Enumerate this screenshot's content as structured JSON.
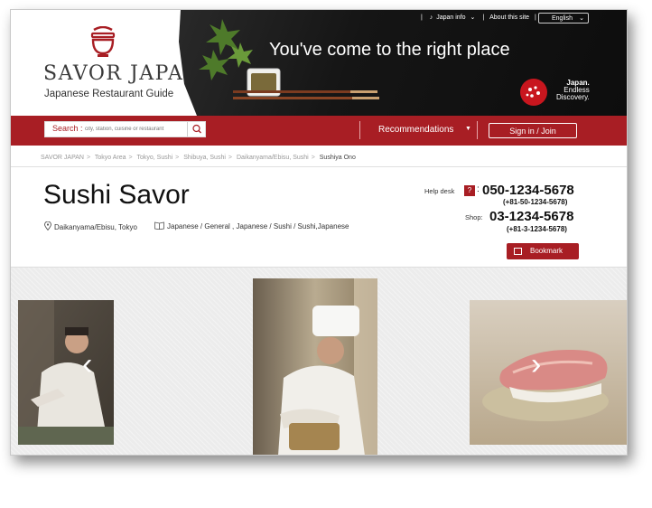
{
  "header": {
    "logo_name": "SAVOR JAPAN",
    "logo_tagline": "Japanese Restaurant Guide",
    "banner_title": "You've come to the right place",
    "top_nav": {
      "japan_info": "Japan info",
      "about": "About this site",
      "language": "English"
    },
    "jp_badge": {
      "line1": "Japan.",
      "line2": "Endless",
      "line3": "Discovery."
    }
  },
  "navbar": {
    "search_label": "Search :",
    "search_placeholder": "city, station, cuisine or restaurant",
    "recommendations": "Recommendations",
    "signin": "Sign in / Join"
  },
  "breadcrumb": [
    "SAVOR JAPAN",
    "Tokyo Area",
    "Tokyo, Sushi",
    "Shibuya, Sushi",
    "Daikanyama/Ebisu, Sushi",
    "Sushiya Ono"
  ],
  "restaurant": {
    "name": "Sushi Savor",
    "location": "Daikanyama/Ebisu, Tokyo",
    "genres": "Japanese / General , Japanese / Sushi / Sushi,Japanese",
    "help_desk_label": "Help desk",
    "help_q": "?",
    "help_number": "050-1234-5678",
    "help_intl": "(+81-50-1234-5678)",
    "shop_label": "Shop:",
    "shop_number": "03-1234-5678",
    "shop_intl": "(+81-3-1234-5678)",
    "bookmark": "Bookmark"
  },
  "colors": {
    "brand_red": "#a81e24",
    "banner_dark": "#111111"
  },
  "icons": [
    "logo-mark-icon",
    "music-note-icon",
    "chevron-down-icon",
    "search-icon",
    "map-pin-icon",
    "book-icon",
    "bookmark-icon",
    "chevron-left-icon",
    "chevron-right-icon"
  ]
}
